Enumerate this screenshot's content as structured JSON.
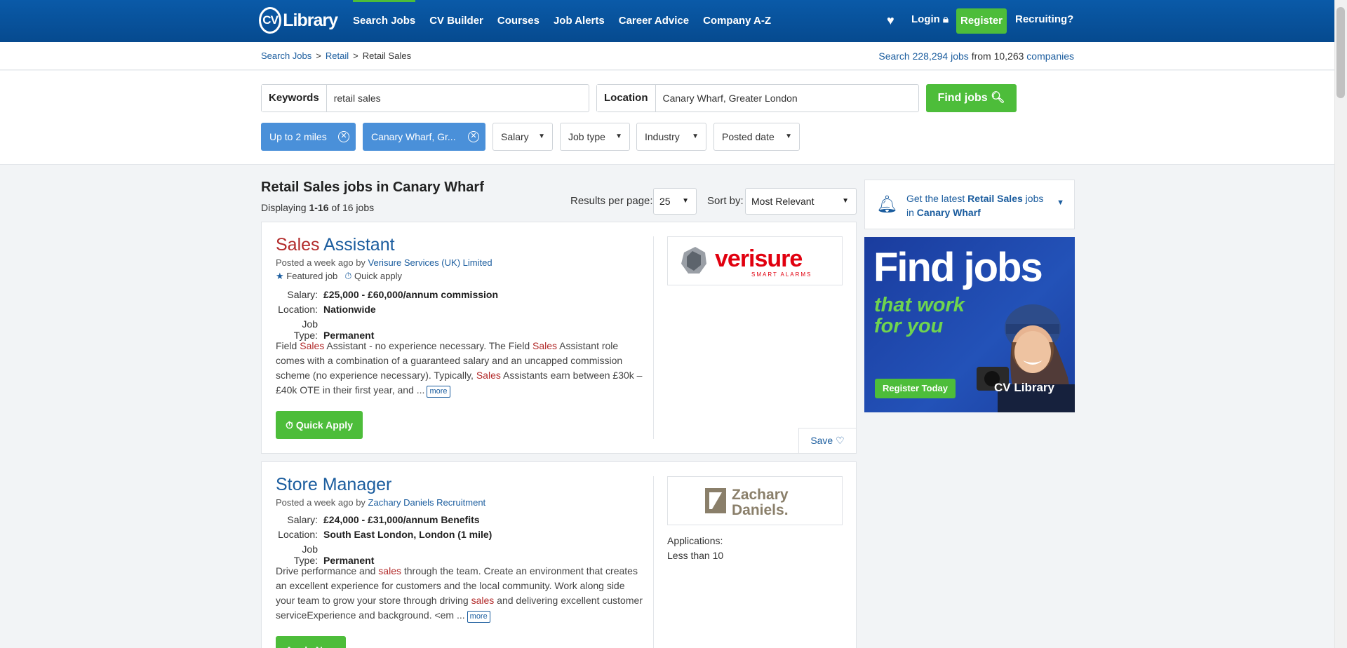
{
  "brand": {
    "cv": "CV",
    "library": "Library"
  },
  "nav": {
    "links": [
      "Search Jobs",
      "CV Builder",
      "Courses",
      "Job Alerts",
      "Career Advice",
      "Company A-Z"
    ],
    "login": "Login",
    "register": "Register",
    "recruiting": "Recruiting?"
  },
  "breadcrumb": {
    "items": [
      "Search Jobs",
      "Retail",
      "Retail Sales"
    ],
    "separator": ">"
  },
  "jobcount": {
    "pre": "Search",
    "jobs": "228,294",
    "jobs_word": "jobs",
    "from": "from",
    "companies": "10,263",
    "companies_word": "companies"
  },
  "search": {
    "keywords_label": "Keywords",
    "keywords_value": "retail sales",
    "location_label": "Location",
    "location_value": "Canary Wharf, Greater London",
    "find_label": "Find jobs"
  },
  "filters": {
    "chips": [
      "Up to 2 miles",
      "Canary Wharf, Gr..."
    ],
    "dropdowns": [
      "Salary",
      "Job type",
      "Industry",
      "Posted date"
    ]
  },
  "results": {
    "title": "Retail Sales jobs in Canary Wharf",
    "displaying": "Displaying",
    "range": "1-16",
    "of": "of 16 jobs",
    "per_page_label": "Results per page:",
    "per_page_value": "25",
    "sort_label": "Sort by:",
    "sort_value": "Most Relevant"
  },
  "jobs": [
    {
      "title_hl": "Sales",
      "title_rest": "Assistant",
      "posted": "Posted a week ago by",
      "company": "Verisure Services (UK) Limited",
      "featured": "Featured job",
      "quick": "Quick apply",
      "salary_k": "Salary:",
      "salary": "£25,000 - £60,000/annum commission",
      "location_k": "Location:",
      "location": "Nationwide",
      "type_k": "Job Type:",
      "type": "Permanent",
      "desc": [
        "Field ",
        "Sales",
        " Assistant - no experience necessary. The Field ",
        "Sales",
        " Assistant role comes with a combination of a guaranteed salary and an uncapped commission scheme (no experience necessary). Typically, ",
        "Sales",
        " Assistants earn between £30k – £40k OTE in their first year, and ..."
      ],
      "more": "more",
      "apply": "Quick Apply",
      "logo_text": "verisure",
      "logo_sub": "SMART ALARMS",
      "save": "Save"
    },
    {
      "title": "Store Manager",
      "posted": "Posted a week ago by",
      "company": "Zachary Daniels Recruitment",
      "salary_k": "Salary:",
      "salary": "£24,000 - £31,000/annum Benefits",
      "location_k": "Location:",
      "location": "South East London, London (1 mile)",
      "type_k": "Job Type:",
      "type": "Permanent",
      "desc": [
        "Drive performance and ",
        "sales",
        " through the team. Create an environment that creates an excellent experience for customers and the local community. Work along side your team to grow your store through driving ",
        "sales",
        " and delivering excellent customer serviceExperience and background. <em ..."
      ],
      "more": "more",
      "apply": "Apply Now",
      "logo_line1": "Zachary",
      "logo_line2": "Daniels.",
      "applications_label": "Applications:",
      "applications_value": "Less than 10"
    }
  ],
  "sidebar": {
    "alert_pre": "Get the latest",
    "alert_kw": "Retail Sales",
    "alert_mid": "jobs in",
    "alert_loc": "Canary Wharf",
    "ad_h1": "Find jobs",
    "ad_h2a": "that work",
    "ad_h2b": "for you",
    "ad_button": "Register Today",
    "ad_logo": "CV Library"
  },
  "colors": {
    "nav": "#0a5aa8",
    "accent_green": "#4dbd3a",
    "link_blue": "#1a5c9e",
    "highlight_red": "#b22a2a",
    "chip_blue": "#4a90d9"
  }
}
